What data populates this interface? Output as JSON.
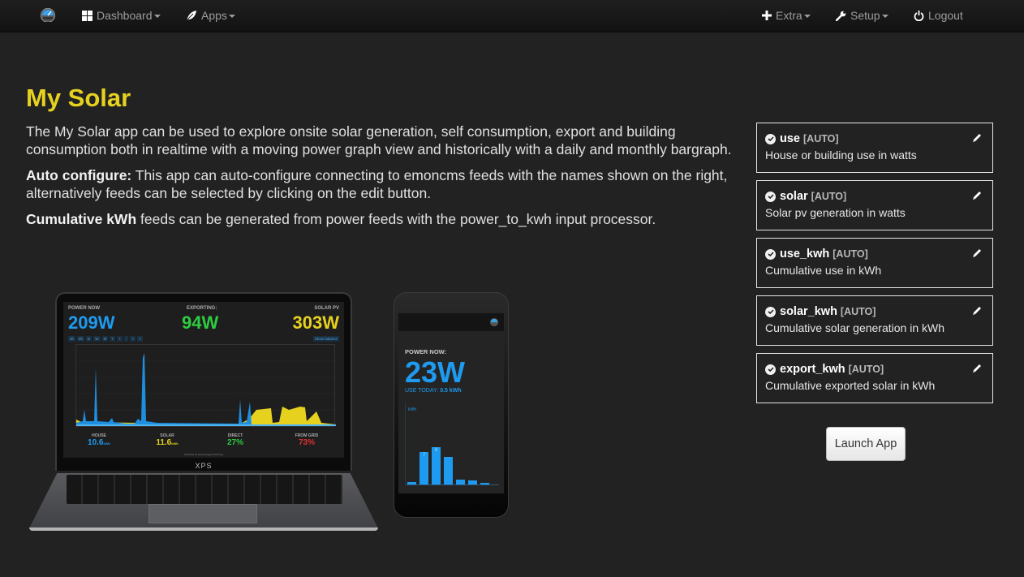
{
  "navbar": {
    "logo_icon": "emoncms-gauge-icon",
    "left_items": [
      {
        "label": "Dashboard",
        "icon": "grid-icon",
        "dropdown": true
      },
      {
        "label": "Apps",
        "icon": "leaf-icon",
        "dropdown": true
      }
    ],
    "right_items": [
      {
        "label": "Extra",
        "icon": "plus-icon",
        "dropdown": true
      },
      {
        "label": "Setup",
        "icon": "wrench-icon",
        "dropdown": true
      },
      {
        "label": "Logout",
        "icon": "power-icon",
        "dropdown": false
      }
    ]
  },
  "page": {
    "title": "My Solar",
    "intro": "The My Solar app can be used to explore onsite solar generation, self consumption, export and building consumption both in realtime with a moving power graph view and historically with a daily and monthly bargraph.",
    "auto_configure_label": "Auto configure:",
    "auto_configure_text": " This app can auto-configure connecting to emoncms feeds with the names shown on the right, alternatively feeds can be selected by clicking on the edit button.",
    "cumulative_label": "Cumulative kWh",
    "cumulative_text": " feeds can be generated from power feeds with the power_to_kwh input processor."
  },
  "feeds": [
    {
      "name": "use",
      "tag": "[AUTO]",
      "description": "House or building use in watts"
    },
    {
      "name": "solar",
      "tag": "[AUTO]",
      "description": "Solar pv generation in watts"
    },
    {
      "name": "use_kwh",
      "tag": "[AUTO]",
      "description": "Cumulative use in kWh"
    },
    {
      "name": "solar_kwh",
      "tag": "[AUTO]",
      "description": "Cumulative solar generation in kWh"
    },
    {
      "name": "export_kwh",
      "tag": "[AUTO]",
      "description": "Cumulative exported solar in kWh"
    }
  ],
  "launch_button": "Launch App",
  "mockup": {
    "laptop": {
      "power_now_label": "POWER NOW",
      "power_now": "209W",
      "exporting_label": "EXPORTING:",
      "exporting": "94W",
      "solar_pv_label": "SOLAR PV",
      "solar_pv": "303W",
      "range_buttons": [
        "3h",
        "6h",
        "D",
        "W",
        "M",
        "Y",
        "+",
        "-",
        "<",
        ">"
      ],
      "show_balance": "Show balance",
      "stats": [
        {
          "label": "HOUSE",
          "value": "10.6",
          "unit": "kWh",
          "color": "#1e9bf0"
        },
        {
          "label": "SOLAR",
          "value": "11.6",
          "unit": "kWh",
          "color": "#e6d11f"
        },
        {
          "label": "DIRECT",
          "value": "27%",
          "unit": "",
          "color": "#2ecc40"
        },
        {
          "label": "FROM GRID",
          "value": "73%",
          "unit": "",
          "color": "#e03030"
        }
      ],
      "powered_by": "Powered by openenergymonitor.org",
      "brand": "XPS"
    },
    "phone": {
      "power_now_label": "POWER NOW:",
      "power_now": "23W",
      "use_today_label": "USE TODAY:",
      "use_today": "0.5 kWh",
      "chart_unit": "kWh",
      "bars": [
        {
          "value": 0.5,
          "label": ""
        },
        {
          "value": 7,
          "label": "7"
        },
        {
          "value": 8,
          "label": "8"
        },
        {
          "value": 6,
          "label": ""
        },
        {
          "value": 1,
          "label": ""
        },
        {
          "value": 0.8,
          "label": ""
        },
        {
          "value": 0.4,
          "label": ""
        }
      ]
    }
  },
  "colors": {
    "title": "#e6d11f",
    "use_blue": "#1e9bf0",
    "solar_yellow": "#e6d11f",
    "export_green": "#2ecc40",
    "grid_red": "#e03030"
  }
}
